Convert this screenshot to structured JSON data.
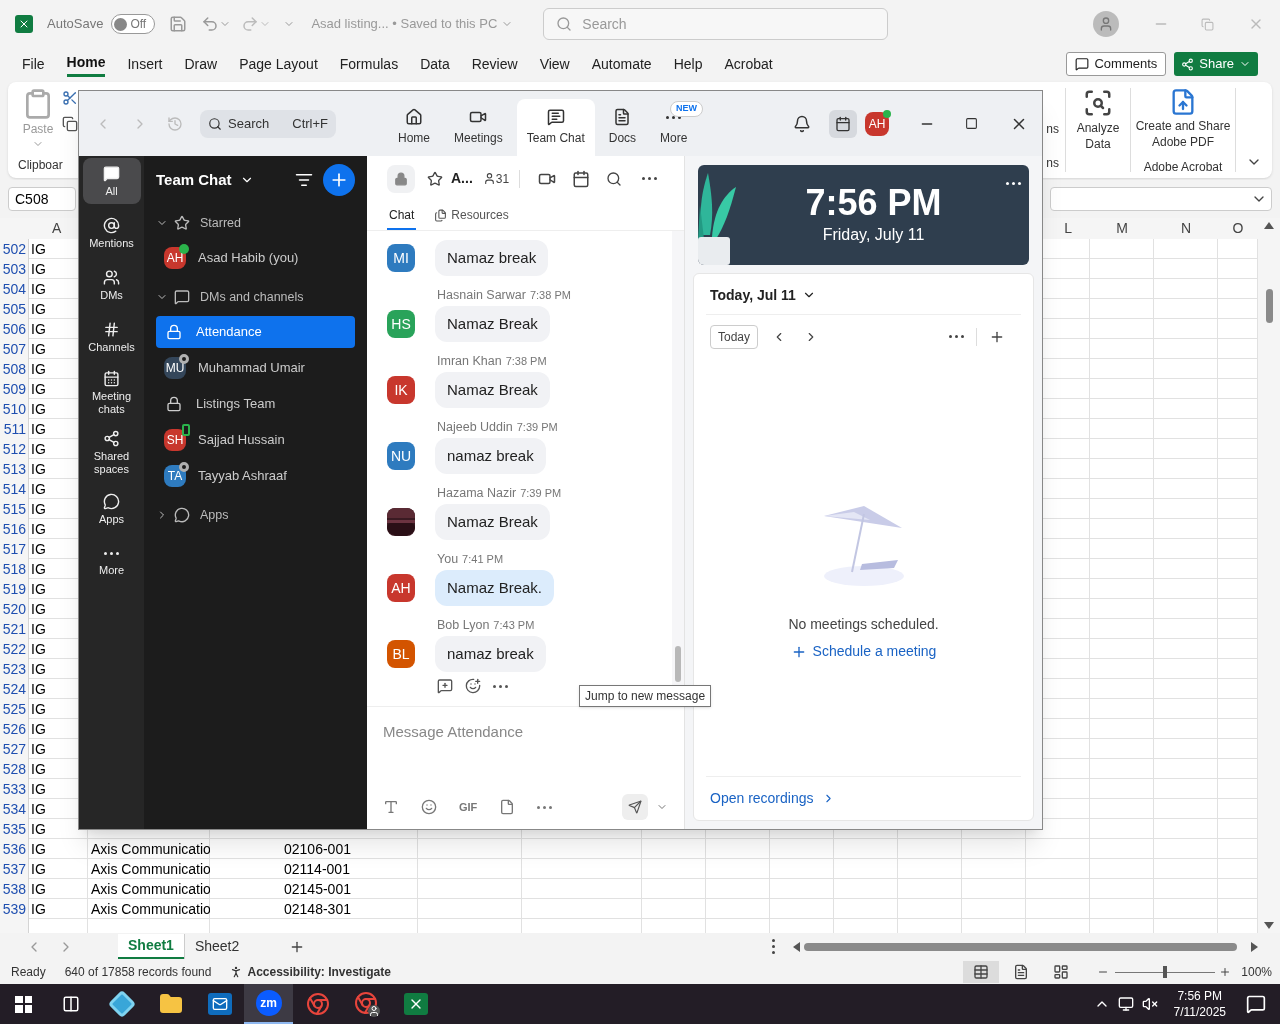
{
  "excel": {
    "title_bar": {
      "autosave_label": "AutoSave",
      "autosave_on": false,
      "autosave_state": "Off",
      "doc_title": "Asad listing... • Saved to this PC",
      "search_placeholder": "Search"
    },
    "menu": [
      {
        "label": "File",
        "selected": false
      },
      {
        "label": "Home",
        "selected": true
      },
      {
        "label": "Insert",
        "selected": false
      },
      {
        "label": "Draw",
        "selected": false
      },
      {
        "label": "Page Layout",
        "selected": false
      },
      {
        "label": "Formulas",
        "selected": false
      },
      {
        "label": "Data",
        "selected": false
      },
      {
        "label": "Review",
        "selected": false
      },
      {
        "label": "View",
        "selected": false
      },
      {
        "label": "Automate",
        "selected": false
      },
      {
        "label": "Help",
        "selected": false
      },
      {
        "label": "Acrobat",
        "selected": false
      }
    ],
    "comments_button": "Comments",
    "share_button": "Share",
    "ribbon": {
      "paste": "Paste",
      "clipboard_group": "Clipboar",
      "fragment_top": "ns",
      "fragment_bottom": "ns",
      "analyze": "Analyze Data",
      "acrobat_button": "Create and Share Adobe PDF",
      "acrobat_group": "Adobe Acrobat"
    },
    "name_box": "C508",
    "columns": [
      "A",
      null,
      null,
      null,
      null,
      null,
      null,
      null,
      null,
      null,
      null,
      "L",
      "M",
      "N",
      "O"
    ],
    "rows": [
      {
        "num": "502",
        "a": "IG"
      },
      {
        "num": "503",
        "a": "IG"
      },
      {
        "num": "504",
        "a": "IG"
      },
      {
        "num": "505",
        "a": "IG"
      },
      {
        "num": "506",
        "a": "IG"
      },
      {
        "num": "507",
        "a": "IG"
      },
      {
        "num": "508",
        "a": "IG"
      },
      {
        "num": "509",
        "a": "IG"
      },
      {
        "num": "510",
        "a": "IG"
      },
      {
        "num": "511",
        "a": "IG"
      },
      {
        "num": "512",
        "a": "IG"
      },
      {
        "num": "513",
        "a": "IG"
      },
      {
        "num": "514",
        "a": "IG"
      },
      {
        "num": "515",
        "a": "IG"
      },
      {
        "num": "516",
        "a": "IG"
      },
      {
        "num": "517",
        "a": "IG"
      },
      {
        "num": "518",
        "a": "IG"
      },
      {
        "num": "519",
        "a": "IG"
      },
      {
        "num": "520",
        "a": "IG"
      },
      {
        "num": "521",
        "a": "IG"
      },
      {
        "num": "522",
        "a": "IG"
      },
      {
        "num": "523",
        "a": "IG"
      },
      {
        "num": "524",
        "a": "IG"
      },
      {
        "num": "525",
        "a": "IG"
      },
      {
        "num": "526",
        "a": "IG"
      },
      {
        "num": "527",
        "a": "IG"
      },
      {
        "num": "528",
        "a": "IG"
      },
      {
        "num": "533",
        "a": "IG"
      },
      {
        "num": "534",
        "a": "IG"
      },
      {
        "num": "535",
        "a": "IG"
      },
      {
        "num": "536",
        "a": "IG",
        "b": "Axis Communicatio",
        "c": "02106-001"
      },
      {
        "num": "537",
        "a": "IG",
        "b": "Axis Communicatio",
        "c": "02114-001"
      },
      {
        "num": "538",
        "a": "IG",
        "b": "Axis Communicatio",
        "c": "02145-001"
      },
      {
        "num": "539",
        "a": "IG",
        "b": "Axis Communicatio",
        "c": "02148-301"
      }
    ],
    "sheets": [
      {
        "label": "Sheet1",
        "selected": true
      },
      {
        "label": "Sheet2",
        "selected": false
      }
    ],
    "status": {
      "ready": "Ready",
      "records": "640 of 17858 records found",
      "accessibility": "Accessibility: Investigate",
      "views": [
        {
          "kind": "normal",
          "selected": true
        },
        {
          "kind": "page",
          "selected": false
        },
        {
          "kind": "break",
          "selected": false
        }
      ],
      "zoom_slider": {
        "level": 0.5
      },
      "zoom": "100%"
    }
  },
  "taskbar": {
    "apps": [
      {
        "kind": "app",
        "active": false
      },
      {
        "kind": "explorer",
        "active": false
      },
      {
        "kind": "outlook",
        "active": false
      },
      {
        "kind": "zoom",
        "label": "zm",
        "active": true
      },
      {
        "kind": "chrome",
        "active": false
      },
      {
        "kind": "chrome-profile",
        "active": false
      },
      {
        "kind": "excel",
        "active": false
      }
    ],
    "time": "7:56 PM",
    "date": "7/11/2025"
  },
  "zoom": {
    "search": {
      "placeholder": "Search",
      "shortcut": "Ctrl+F"
    },
    "nav_tabs": [
      {
        "label": "Home",
        "kind": "home",
        "selected": false
      },
      {
        "label": "Meetings",
        "kind": "meetings",
        "selected": false
      },
      {
        "label": "Team Chat",
        "kind": "chat",
        "selected": true
      },
      {
        "label": "Docs",
        "kind": "docs",
        "selected": false
      },
      {
        "label": "More",
        "kind": "more",
        "selected": false,
        "badge": "NEW"
      }
    ],
    "profile": {
      "initials": "AH",
      "color": "#c8372d",
      "online": true
    },
    "rail": [
      {
        "label": "All",
        "kind": "all",
        "selected": true
      },
      {
        "label": "Mentions",
        "kind": "mentions",
        "selected": false
      },
      {
        "label": "DMs",
        "kind": "dms",
        "selected": false
      },
      {
        "label": "Channels",
        "kind": "channels",
        "selected": false
      },
      {
        "label": "Meeting chats",
        "kind": "meetings",
        "selected": false
      },
      {
        "label": "Shared spaces",
        "kind": "shared",
        "selected": false
      },
      {
        "label": "Apps",
        "kind": "apps",
        "selected": false
      },
      {
        "label": "More",
        "kind": "more",
        "selected": false
      }
    ],
    "list": {
      "title": "Team Chat",
      "sections": [
        {
          "label": "Starred",
          "kind": "star",
          "expanded": true,
          "items": [
            {
              "name": "Asad Habib (you)",
              "kind": "person",
              "initials": "AH",
              "color": "#c8372d",
              "online": true,
              "mobile": false,
              "selected": false
            }
          ]
        },
        {
          "label": "DMs and channels",
          "kind": "chat",
          "expanded": true,
          "items": [
            {
              "name": "Attendance",
              "kind": "channel",
              "selected": true
            },
            {
              "name": "Muhammad Umair",
              "kind": "person",
              "initials": "MU",
              "color": "#34465a",
              "online": false,
              "mobile": false,
              "selected": false
            },
            {
              "name": "Listings Team",
              "kind": "channel",
              "selected": false
            },
            {
              "name": "Sajjad Hussain",
              "kind": "person",
              "initials": "SH",
              "color": "#c8372d",
              "online": true,
              "mobile": true,
              "selected": false
            },
            {
              "name": "Tayyab Ashraaf",
              "kind": "person",
              "initials": "TA",
              "color": "#2e7bbf",
              "online": false,
              "mobile": false,
              "selected": false
            }
          ]
        },
        {
          "label": "Apps",
          "kind": "apps",
          "expanded": false
        }
      ]
    },
    "channel": {
      "title": "A...",
      "members": "31",
      "tabs": [
        {
          "label": "Chat",
          "selected": true
        },
        {
          "label": "Resources",
          "selected": false
        }
      ]
    },
    "messages": [
      {
        "kind": "initials",
        "initials": "MI",
        "color": "#2e7bbf",
        "text": "Namaz break",
        "mine": false
      },
      {
        "sender": "Hasnain Sarwar",
        "time": "7:38 PM",
        "kind": "initials",
        "initials": "HS",
        "color": "#29a35a",
        "text": "Namaz Break",
        "mine": false
      },
      {
        "sender": "Imran Khan",
        "time": "7:38 PM",
        "kind": "initials",
        "initials": "IK",
        "color": "#c8372d",
        "text": "Namaz Break",
        "mine": false
      },
      {
        "sender": "Najeeb Uddin",
        "time": "7:39 PM",
        "kind": "initials",
        "initials": "NU",
        "color": "#2e7bbf",
        "text": "namaz break",
        "mine": false
      },
      {
        "sender": "Hazama Nazir",
        "time": "7:39 PM",
        "kind": "picture",
        "text": "Namaz Break",
        "mine": false
      },
      {
        "sender": "You",
        "time": "7:41 PM",
        "kind": "initials",
        "initials": "AH",
        "color": "#c8372d",
        "text": "Namaz Break.",
        "mine": true
      },
      {
        "sender": "Bob Lyon",
        "time": "7:43 PM",
        "kind": "initials",
        "initials": "BL",
        "color": "#d35400",
        "text": "namaz break",
        "mine": false
      }
    ],
    "tooltip": "Jump to new message",
    "composer": {
      "placeholder": "Message Attendance",
      "gif": "GIF"
    },
    "clock": {
      "time": "7:56 PM",
      "date": "Friday, July 11"
    },
    "calendar": {
      "date_label": "Today, Jul 11",
      "today_button": "Today",
      "empty": "No meetings scheduled.",
      "schedule_link": "Schedule a meeting",
      "recordings_link": "Open recordings"
    }
  }
}
